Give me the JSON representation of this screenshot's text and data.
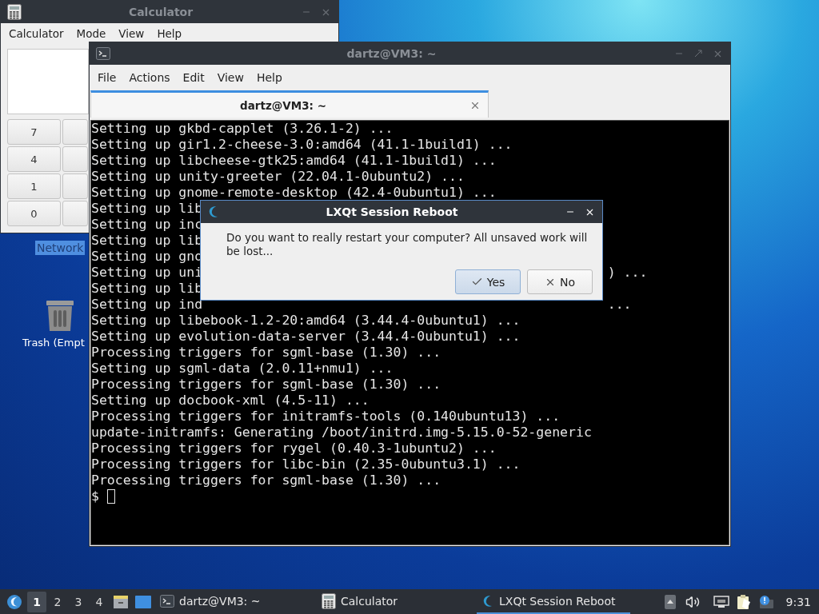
{
  "desktop": {
    "icons": [
      {
        "label": "Network",
        "kind": "network",
        "selected": true
      },
      {
        "label": "Trash (Empt",
        "kind": "trash",
        "selected": false
      }
    ]
  },
  "calculator": {
    "title": "Calculator",
    "active": false,
    "menu": [
      "Calculator",
      "Mode",
      "View",
      "Help"
    ],
    "keys": [
      "7",
      "4",
      "1",
      "0"
    ]
  },
  "terminal": {
    "title": "dartz@VM3: ~",
    "active": false,
    "menu": [
      "File",
      "Actions",
      "Edit",
      "View",
      "Help"
    ],
    "tabs": [
      {
        "label": "dartz@VM3: ~",
        "selected": true
      }
    ],
    "lines": [
      {
        "text": "Setting up gkbd-capplet (3.26.1-2) ..."
      },
      {
        "text": "Setting up gir1.2-cheese-3.0:amd64 (41.1-1build1) ..."
      },
      {
        "text": "Setting up libcheese-gtk25:amd64 (41.1-1build1) ..."
      },
      {
        "text": "Setting up unity-greeter (22.04.1-0ubuntu2) ..."
      },
      {
        "text": "Setting up gnome-remote-desktop (42.4-0ubuntu1) ..."
      },
      {
        "text": "Setting up lib"
      },
      {
        "text": "Setting up inc"
      },
      {
        "text": "Setting up lib"
      },
      {
        "text": "Setting up gno"
      },
      {
        "text": "Setting up uni",
        "tail": ") ..."
      },
      {
        "text": "Setting up lib"
      },
      {
        "text": "Setting up ind",
        "tail": "..."
      },
      {
        "text": "Setting up libebook-1.2-20:amd64 (3.44.4-0ubuntu1) ..."
      },
      {
        "text": "Setting up evolution-data-server (3.44.4-0ubuntu1) ..."
      },
      {
        "text": "Processing triggers for sgml-base (1.30) ..."
      },
      {
        "text": "Setting up sgml-data (2.0.11+nmu1) ..."
      },
      {
        "text": "Processing triggers for sgml-base (1.30) ..."
      },
      {
        "text": "Setting up docbook-xml (4.5-11) ..."
      },
      {
        "text": "Processing triggers for initramfs-tools (0.140ubuntu13) ..."
      },
      {
        "text": "update-initramfs: Generating /boot/initrd.img-5.15.0-52-generic"
      },
      {
        "text": "Processing triggers for rygel (0.40.3-1ubuntu2) ..."
      },
      {
        "text": "Processing triggers for libc-bin (2.35-0ubuntu3.1) ..."
      },
      {
        "text": "Processing triggers for sgml-base (1.30) ..."
      }
    ],
    "prompt": "$"
  },
  "dialog": {
    "title": "LXQt Session Reboot",
    "message": "Do you want to really restart your computer? All unsaved work will be lost...",
    "buttons": [
      {
        "label": "Yes",
        "kind": "confirm",
        "focused": true
      },
      {
        "label": "No",
        "kind": "cancel",
        "focused": false
      }
    ]
  },
  "taskbar": {
    "desktops": [
      {
        "label": "1",
        "selected": true
      },
      {
        "label": "2",
        "selected": false
      },
      {
        "label": "3",
        "selected": false
      },
      {
        "label": "4",
        "selected": false
      }
    ],
    "tasks": [
      {
        "label": "dartz@VM3: ~",
        "kind": "terminal",
        "selected": false
      },
      {
        "label": "Calculator",
        "kind": "calculator",
        "selected": false
      },
      {
        "label": "LXQt Session Reboot",
        "kind": "reboot",
        "selected": true
      }
    ],
    "clock": "9:31"
  }
}
